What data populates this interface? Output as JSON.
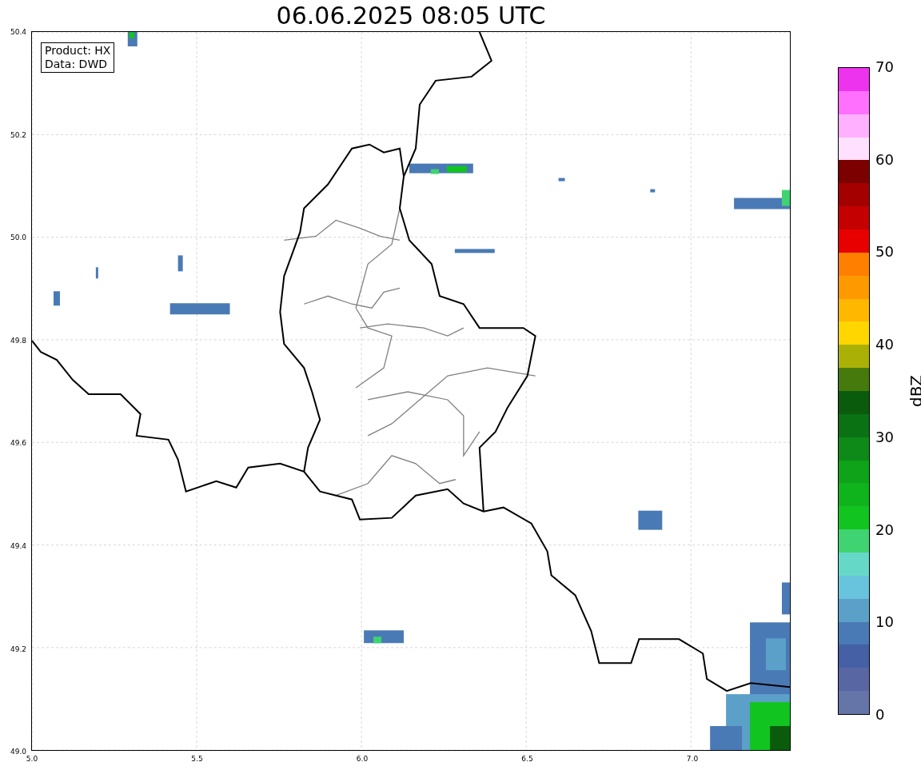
{
  "title": "06.06.2025 08:05 UTC",
  "info_box": [
    "Product: HX",
    "Data: DWD"
  ],
  "x_ticks": [
    "5.0",
    "5.5",
    "6.0",
    "6.5",
    "7.0"
  ],
  "y_ticks": [
    "50.4",
    "50.2",
    "50.0",
    "49.8",
    "49.6",
    "49.4",
    "49.2",
    "49.0"
  ],
  "colorbar": {
    "label": "dBZ",
    "ticks": [
      "70",
      "60",
      "50",
      "40",
      "30",
      "20",
      "10",
      "0"
    ],
    "bins": [
      {
        "color": "#6575a8"
      },
      {
        "color": "#5867a3"
      },
      {
        "color": "#4560a5"
      },
      {
        "color": "#4a7ab5"
      },
      {
        "color": "#5ba0c8"
      },
      {
        "color": "#68c3dc"
      },
      {
        "color": "#66d8c8"
      },
      {
        "color": "#3fd471"
      },
      {
        "color": "#12c41f"
      },
      {
        "color": "#0fb31b"
      },
      {
        "color": "#0ea318"
      },
      {
        "color": "#0d8a18"
      },
      {
        "color": "#0b7214"
      },
      {
        "color": "#0a5c0c"
      },
      {
        "color": "#467a0c"
      },
      {
        "color": "#abb007"
      },
      {
        "color": "#ffd600"
      },
      {
        "color": "#ffb700"
      },
      {
        "color": "#ff9900"
      },
      {
        "color": "#ff7f00"
      },
      {
        "color": "#e80000"
      },
      {
        "color": "#c40000"
      },
      {
        "color": "#a40000"
      },
      {
        "color": "#7d0000"
      },
      {
        "color": "#ffe0ff"
      },
      {
        "color": "#ffb0ff"
      },
      {
        "color": "#ff70ff"
      },
      {
        "color": "#ee33ee"
      }
    ]
  }
}
